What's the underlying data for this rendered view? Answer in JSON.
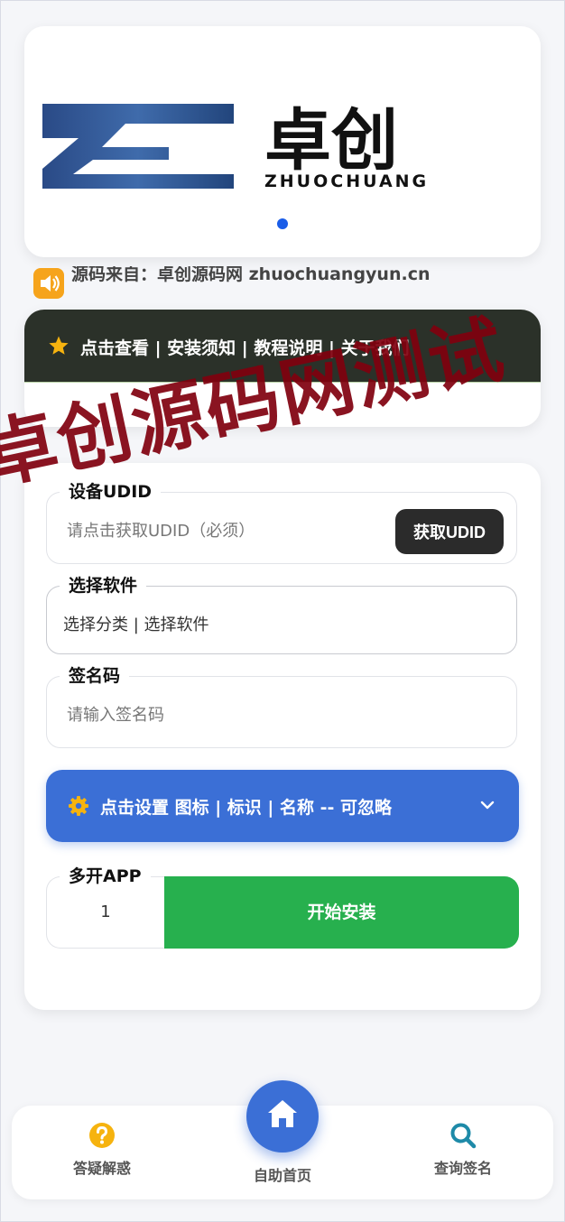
{
  "banner": {
    "logo_text": "卓创",
    "logo_subtext": "ZHUOCHUANG"
  },
  "notice": {
    "text": "源码来自：卓创源码网 zhuochuangyun.cn",
    "icon": "speaker-icon"
  },
  "menu": {
    "text": "点击查看 | 安装须知 | 教程说明 | 关于我们",
    "icon": "star-icon"
  },
  "form": {
    "udid": {
      "label": "设备UDID",
      "placeholder": "请点击获取UDID（必须）",
      "button": "获取UDID"
    },
    "software": {
      "label": "选择软件",
      "value": "选择分类 | 选择软件"
    },
    "sign_code": {
      "label": "签名码",
      "placeholder": "请输入签名码"
    },
    "settings": {
      "text": "点击设置 图标 | 标识 | 名称 -- 可忽略",
      "icon": "gear-icon"
    },
    "multi": {
      "label": "多开APP",
      "value": "1"
    },
    "install_button": "开始安装"
  },
  "nav": {
    "items": [
      {
        "label": "答疑解惑",
        "icon": "question-circle-icon"
      },
      {
        "label": "自助首页",
        "icon": "home-icon"
      },
      {
        "label": "查询签名",
        "icon": "search-icon"
      }
    ]
  },
  "watermark": "卓创源码网测试",
  "colors": {
    "primary_blue": "#3b6fd6",
    "install_green": "#27b04e",
    "dark_bar": "#2b3129",
    "watermark_red": "#80000e",
    "accent_orange": "#f6a41c"
  }
}
